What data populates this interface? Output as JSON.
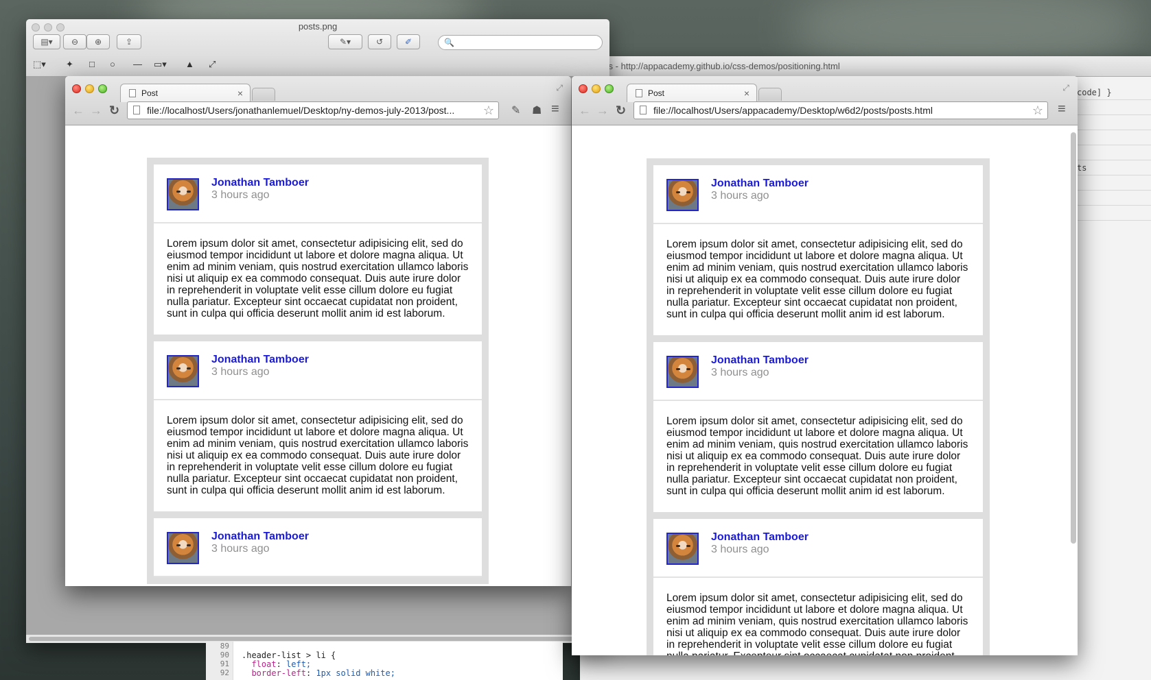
{
  "preview": {
    "title": "posts.png"
  },
  "devtools": {
    "title": "r Tools - http://appacademy.github.io/css-demos/positioning.html",
    "rows": [
      "code] }",
      "",
      "",
      "",
      "",
      "ts",
      "",
      "",
      ""
    ]
  },
  "code": {
    "lines": [
      {
        "n": "89",
        "text": ""
      },
      {
        "n": "90",
        "text": ".header-list > li {"
      },
      {
        "n": "91",
        "prop": "float",
        "val": "left;"
      },
      {
        "n": "92",
        "prop": "border-left",
        "val": "1px solid white;"
      }
    ]
  },
  "browser_left": {
    "tab_title": "Post",
    "url": "file://localhost/Users/jonathanlemuel/Desktop/ny-demos-july-2013/post..."
  },
  "browser_right": {
    "tab_title": "Post",
    "url": "file://localhost/Users/appacademy/Desktop/w6d2/posts/posts.html"
  },
  "post": {
    "author": "Jonathan Tamboer",
    "time": "3 hours ago",
    "body": "Lorem ipsum dolor sit amet, consectetur adipisicing elit, sed do eiusmod tempor incididunt ut labore et dolore magna aliqua. Ut enim ad minim veniam, quis nostrud exercitation ullamco laboris nisi ut aliquip ex ea commodo consequat. Duis aute irure dolor in reprehenderit in voluptate velit esse cillum dolore eu fugiat nulla pariatur. Excepteur sint occaecat cupidatat non proident, sunt in culpa qui officia deserunt mollit anim id est laborum."
  },
  "icons": {
    "back": "←",
    "forward": "→",
    "reload": "↻",
    "star": "☆",
    "menu": "≡",
    "wrench": "🔧",
    "close": "×"
  }
}
